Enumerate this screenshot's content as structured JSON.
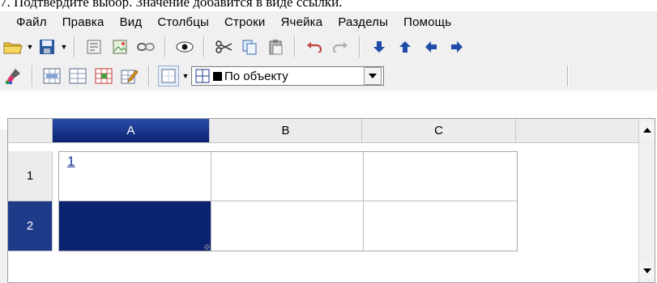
{
  "caption": "7. Подтвердите выбор. Значение добавится в виде ссылки.",
  "menu": [
    "Файл",
    "Правка",
    "Вид",
    "Столбцы",
    "Строки",
    "Ячейка",
    "Разделы",
    "Помощь"
  ],
  "toolbar1": {
    "buttons": [
      "open-folder-icon",
      "save-disk-icon",
      "properties-icon",
      "image-icon",
      "link-icon",
      "eye-icon",
      "cut-scissors-icon",
      "copy-icon",
      "paste-icon",
      "undo-icon",
      "redo-icon",
      "move-down-icon",
      "move-up-icon",
      "move-left-icon",
      "move-right-icon"
    ]
  },
  "toolbar2": {
    "buttons": [
      "brush-icon",
      "insert-row-icon",
      "table-icon",
      "table-red-icon",
      "edit-table-icon",
      "borders-icon"
    ],
    "border_select": "По объекту"
  },
  "grid": {
    "columns": [
      "A",
      "B",
      "C"
    ],
    "rows": [
      "1",
      "2"
    ],
    "cell_a1": "1",
    "selected_column": "A",
    "selected_row": "2",
    "selection_color": "#0b2271"
  }
}
